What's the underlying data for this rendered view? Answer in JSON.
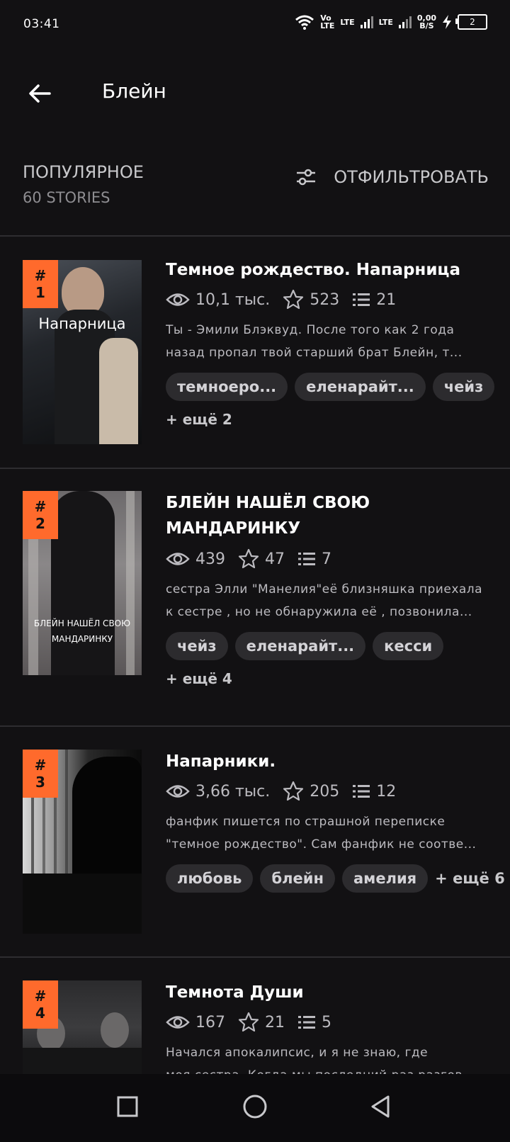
{
  "status_bar": {
    "time": "03:41",
    "lte1_top": "Vo",
    "lte1_bottom": "LTE",
    "lte2": "LTE",
    "lte3": "LTE",
    "speed_value": "0,00",
    "speed_unit": "B/S",
    "battery": "2"
  },
  "header": {
    "title": "Блейн"
  },
  "section": {
    "title": "ПОПУЛЯРНОЕ",
    "count": "60 STORIES",
    "filter_label": "ОТФИЛЬТРОВАТЬ"
  },
  "stories": [
    {
      "rank": "# 1",
      "cover_text": "Напарница",
      "title": "Темное рождество. Напарница",
      "views": "10,1 тыс.",
      "votes": "523",
      "parts": "21",
      "desc1": "Ты - Эмили Блэквуд. После того как 2 года",
      "desc2": "назад пропал твой старший брат Блейн, т...",
      "tags": [
        "темноеро...",
        "еленарайт...",
        "чейз"
      ],
      "more": "+ ещё 2"
    },
    {
      "rank": "# 2",
      "cover_text1": "БЛЕЙН НАШЁЛ СВОЮ",
      "cover_text2": "МАНДАРИНКУ",
      "title1": "БЛЕЙН НАШЁЛ СВОЮ",
      "title2": "МАНДАРИНКУ",
      "views": "439",
      "votes": "47",
      "parts": "7",
      "desc1": "сестра Элли \"Манелия\"её близняшка приехала",
      "desc2": "к сестре , но не обнаружила её , позвонила...",
      "tags": [
        "чейз",
        "еленарайт...",
        "кесси"
      ],
      "more": "+ ещё 4"
    },
    {
      "rank": "# 3",
      "title": "Напарники.",
      "views": "3,66 тыс.",
      "votes": "205",
      "parts": "12",
      "desc1": "фанфик пишется по страшной переписке",
      "desc2": "\"темное рождество\". Сам фанфик не соотве...",
      "tags": [
        "любовь",
        "блейн",
        "амелия"
      ],
      "more": "+ ещё 6"
    },
    {
      "rank": "# 4",
      "title": "Темнота Души",
      "views": "167",
      "votes": "21",
      "parts": "5",
      "desc1": "Начался апокалипсис, и я не знаю, где",
      "desc2": "моя сестра. Когда мы последний раз разгов..."
    }
  ]
}
